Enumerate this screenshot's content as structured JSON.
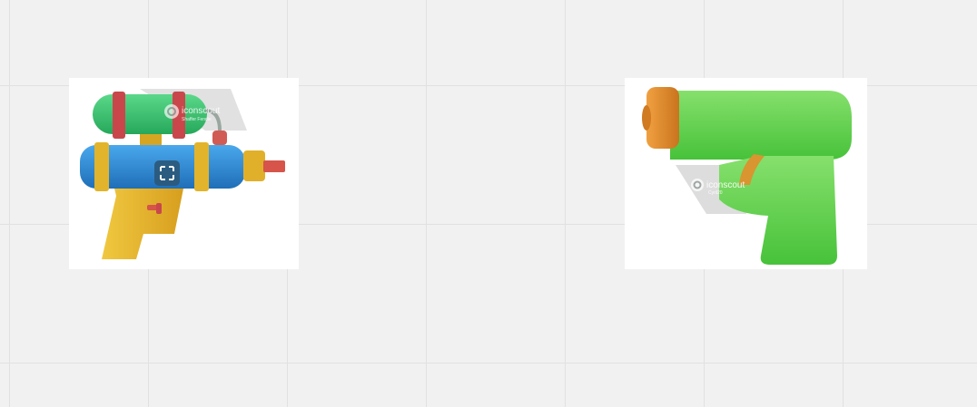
{
  "canvas": {
    "background": "#f1f1f1",
    "grid_color": "#e1e1e1"
  },
  "images": [
    {
      "subject": "water-gun-tank-icon",
      "watermark": {
        "brand": "iconscout",
        "sub": "Shaffer Fendie"
      },
      "overlay_icon": "expand-icon",
      "colors": {
        "tank": "#34c36e",
        "barrel": "#2f8fd8",
        "grip": "#e6b52c",
        "nozzle": "#d6544a"
      }
    },
    {
      "subject": "green-water-pistol-icon",
      "watermark": {
        "brand": "iconscout",
        "sub": "Cyril20"
      },
      "colors": {
        "body": "#5fd24a",
        "cap": "#e08a2a"
      }
    }
  ]
}
